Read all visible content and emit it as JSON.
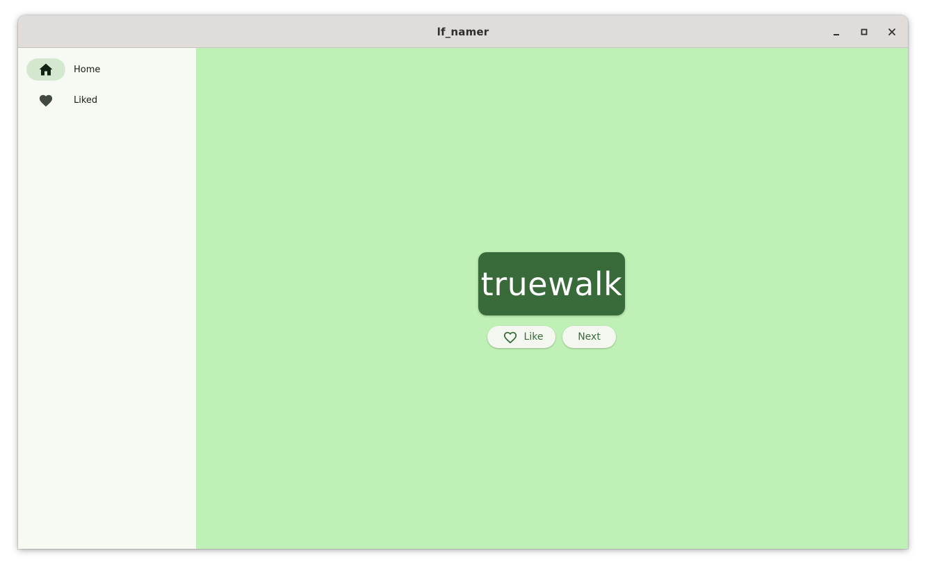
{
  "window": {
    "title": "lf_namer",
    "controls": {
      "minimize_icon": "minimize-icon",
      "maximize_icon": "maximize-icon",
      "close_icon": "close-icon"
    }
  },
  "sidebar": {
    "items": [
      {
        "label": "Home",
        "icon": "home-icon",
        "selected": true
      },
      {
        "label": "Liked",
        "icon": "heart-icon",
        "selected": false
      }
    ]
  },
  "main": {
    "current_word": "truewalk",
    "buttons": {
      "like_label": "Like",
      "like_icon": "heart-outline-icon",
      "next_label": "Next"
    }
  },
  "colors": {
    "main_background": "#bff0b5",
    "sidebar_background": "#f7f9f3",
    "card_background": "#386a3a",
    "selected_indicator": "#d4e8d0",
    "button_text": "#386a3a",
    "titlebar": "#dfdcd9"
  }
}
